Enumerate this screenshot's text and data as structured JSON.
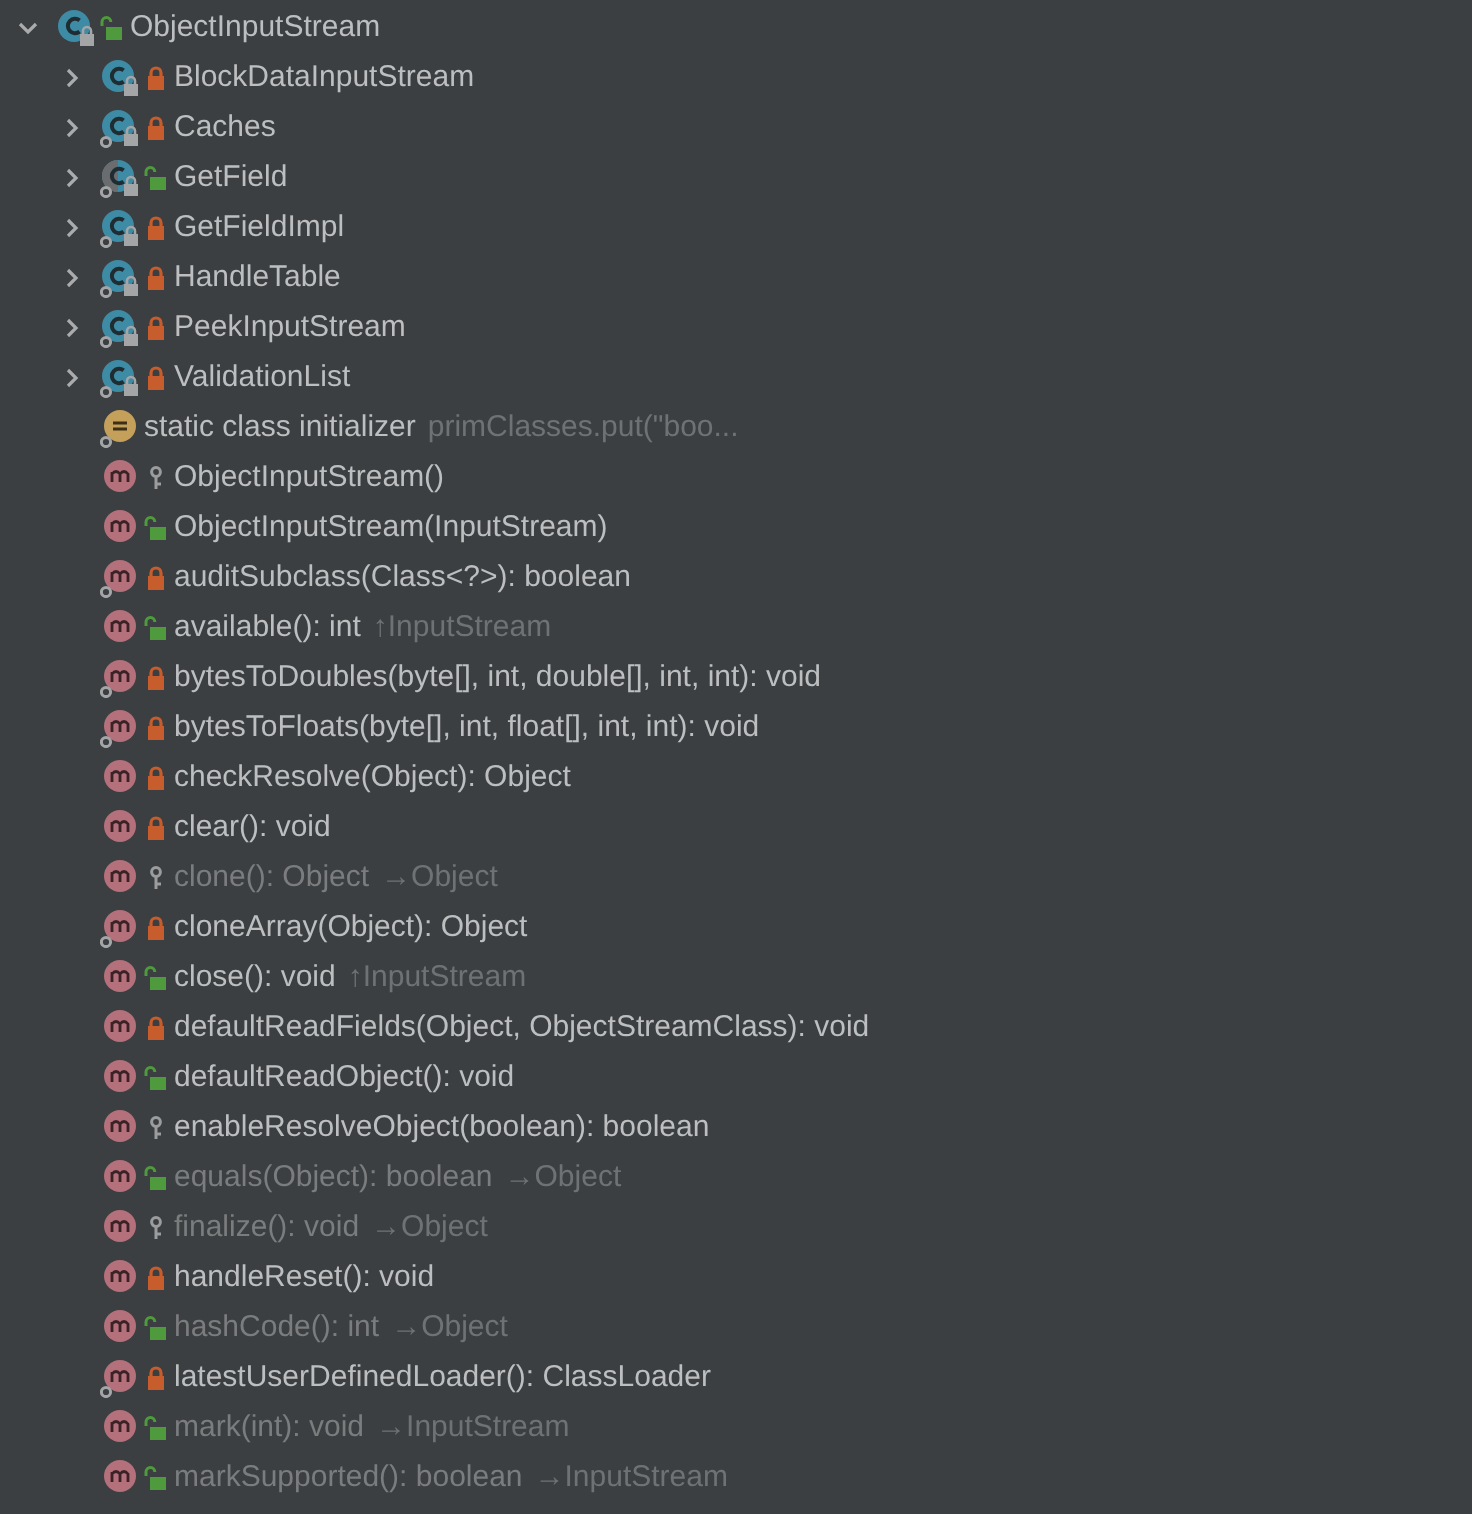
{
  "root": {
    "kind": "class",
    "name": "ObjectInputStream",
    "access": {
      "kind": "public"
    },
    "static": false,
    "expanded": true,
    "children": [
      {
        "kind": "class",
        "name": "BlockDataInputStream",
        "access": {
          "kind": "private"
        },
        "static": false,
        "expanded": false
      },
      {
        "kind": "class",
        "name": "Caches",
        "access": {
          "kind": "private"
        },
        "static": true,
        "expanded": false
      },
      {
        "kind": "class",
        "name": "GetField",
        "access": {
          "kind": "public"
        },
        "static": true,
        "abstract": true,
        "expanded": false
      },
      {
        "kind": "class",
        "name": "GetFieldImpl",
        "access": {
          "kind": "private"
        },
        "static": true,
        "expanded": false
      },
      {
        "kind": "class",
        "name": "HandleTable",
        "access": {
          "kind": "private"
        },
        "static": true,
        "expanded": false
      },
      {
        "kind": "class",
        "name": "PeekInputStream",
        "access": {
          "kind": "private"
        },
        "static": true,
        "expanded": false
      },
      {
        "kind": "class",
        "name": "ValidationList",
        "access": {
          "kind": "private"
        },
        "static": true,
        "expanded": false
      },
      {
        "kind": "initializer",
        "name": "static class initializer",
        "suffix": "primClasses.put(\"boo...",
        "static": true
      },
      {
        "kind": "method",
        "name": "ObjectInputStream()",
        "access": {
          "kind": "protected"
        },
        "static": false,
        "inherited": false
      },
      {
        "kind": "method",
        "name": "ObjectInputStream(InputStream)",
        "access": {
          "kind": "public"
        },
        "static": false,
        "inherited": false
      },
      {
        "kind": "method",
        "name": "auditSubclass(Class<?>): boolean",
        "access": {
          "kind": "private"
        },
        "static": true,
        "inherited": false
      },
      {
        "kind": "method",
        "name": "available(): int",
        "suffix": "↑InputStream",
        "access": {
          "kind": "public"
        },
        "static": false,
        "inherited": false
      },
      {
        "kind": "method",
        "name": "bytesToDoubles(byte[], int, double[], int, int): void",
        "access": {
          "kind": "private"
        },
        "static": true,
        "inherited": false
      },
      {
        "kind": "method",
        "name": "bytesToFloats(byte[], int, float[], int, int): void",
        "access": {
          "kind": "private"
        },
        "static": true,
        "inherited": false
      },
      {
        "kind": "method",
        "name": "checkResolve(Object): Object",
        "access": {
          "kind": "private"
        },
        "static": false,
        "inherited": false
      },
      {
        "kind": "method",
        "name": "clear(): void",
        "access": {
          "kind": "private"
        },
        "static": false,
        "inherited": false
      },
      {
        "kind": "method",
        "name": "clone(): Object",
        "suffix": "→Object",
        "access": {
          "kind": "protected"
        },
        "static": false,
        "inherited": true
      },
      {
        "kind": "method",
        "name": "cloneArray(Object): Object",
        "access": {
          "kind": "private"
        },
        "static": true,
        "inherited": false
      },
      {
        "kind": "method",
        "name": "close(): void",
        "suffix": "↑InputStream",
        "access": {
          "kind": "public"
        },
        "static": false,
        "inherited": false
      },
      {
        "kind": "method",
        "name": "defaultReadFields(Object, ObjectStreamClass): void",
        "access": {
          "kind": "private"
        },
        "static": false,
        "inherited": false
      },
      {
        "kind": "method",
        "name": "defaultReadObject(): void",
        "access": {
          "kind": "public"
        },
        "static": false,
        "inherited": false
      },
      {
        "kind": "method",
        "name": "enableResolveObject(boolean): boolean",
        "access": {
          "kind": "protected"
        },
        "static": false,
        "inherited": false
      },
      {
        "kind": "method",
        "name": "equals(Object): boolean",
        "suffix": "→Object",
        "access": {
          "kind": "public"
        },
        "static": false,
        "inherited": true
      },
      {
        "kind": "method",
        "name": "finalize(): void",
        "suffix": "→Object",
        "access": {
          "kind": "protected"
        },
        "static": false,
        "inherited": true
      },
      {
        "kind": "method",
        "name": "handleReset(): void",
        "access": {
          "kind": "private"
        },
        "static": false,
        "inherited": false
      },
      {
        "kind": "method",
        "name": "hashCode(): int",
        "suffix": "→Object",
        "access": {
          "kind": "public"
        },
        "static": false,
        "inherited": true
      },
      {
        "kind": "method",
        "name": "latestUserDefinedLoader(): ClassLoader",
        "access": {
          "kind": "private"
        },
        "static": true,
        "inherited": false
      },
      {
        "kind": "method",
        "name": "mark(int): void",
        "suffix": "→InputStream",
        "access": {
          "kind": "public"
        },
        "static": false,
        "inherited": true
      },
      {
        "kind": "method",
        "name": "markSupported(): boolean",
        "suffix": "→InputStream",
        "access": {
          "kind": "public"
        },
        "static": false,
        "inherited": true
      }
    ]
  }
}
